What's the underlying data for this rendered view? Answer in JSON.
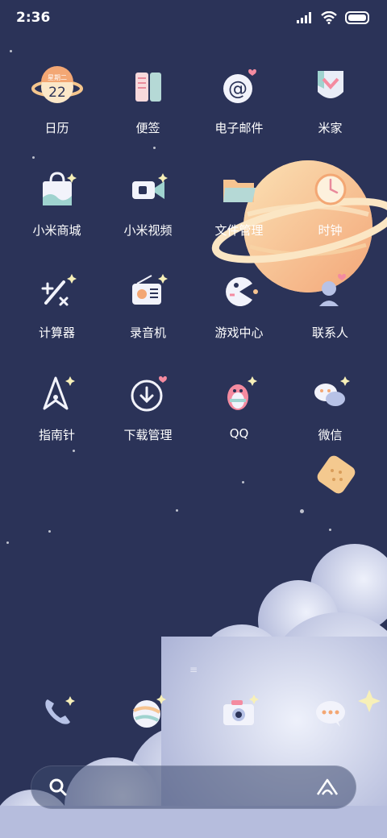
{
  "status_bar": {
    "time": "2:36",
    "icons": [
      "signal-icon",
      "wifi-icon",
      "battery-icon"
    ]
  },
  "calendar_widget": {
    "weekday": "星期二",
    "day": "22"
  },
  "apps": [
    {
      "label": "日历",
      "icon": "calendar-icon"
    },
    {
      "label": "便签",
      "icon": "notes-icon"
    },
    {
      "label": "电子邮件",
      "icon": "email-icon"
    },
    {
      "label": "米家",
      "icon": "mijia-icon"
    },
    {
      "label": "小米商城",
      "icon": "shopping-bag-icon"
    },
    {
      "label": "小米视频",
      "icon": "video-icon"
    },
    {
      "label": "文件管理",
      "icon": "folder-icon"
    },
    {
      "label": "时钟",
      "icon": "clock-icon"
    },
    {
      "label": "计算器",
      "icon": "calculator-icon"
    },
    {
      "label": "录音机",
      "icon": "recorder-icon"
    },
    {
      "label": "游戏中心",
      "icon": "game-icon"
    },
    {
      "label": "联系人",
      "icon": "contacts-icon"
    },
    {
      "label": "指南针",
      "icon": "compass-icon"
    },
    {
      "label": "下载管理",
      "icon": "download-icon"
    },
    {
      "label": "QQ",
      "icon": "qq-icon"
    },
    {
      "label": "微信",
      "icon": "wechat-icon"
    }
  ],
  "dock": [
    {
      "name": "phone",
      "icon": "phone-icon"
    },
    {
      "name": "browser",
      "icon": "browser-icon"
    },
    {
      "name": "camera",
      "icon": "camera-icon"
    },
    {
      "name": "messages",
      "icon": "messages-icon"
    }
  ],
  "page_indicator": "≡",
  "search": {
    "left_icon": "search-icon",
    "right_icon": "assistant-icon"
  },
  "colors": {
    "background": "#2b3358",
    "planet": "#f5c08a",
    "cloud": "#c9cfe8",
    "accent_pink": "#f48ba0"
  }
}
